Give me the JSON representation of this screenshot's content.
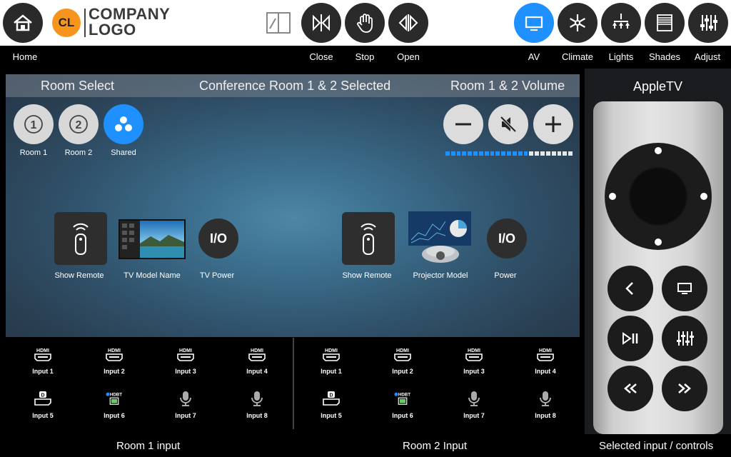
{
  "logo": {
    "mark": "CL",
    "line1": "COMPANY",
    "line2": "LOGO"
  },
  "top_icons": {
    "home": "home-icon",
    "door": "door-icon",
    "close": "close-curtain-icon",
    "stop": "stop-hand-icon",
    "open": "open-curtain-icon",
    "av": "tv-icon",
    "climate": "snowflake-icon",
    "lights": "chandelier-icon",
    "shades": "shades-icon",
    "adjust": "sliders-icon"
  },
  "nav": {
    "home": "Home",
    "close": "Close",
    "stop": "Stop",
    "open": "Open",
    "av": "AV",
    "climate": "Climate",
    "lights": "Lights",
    "shades": "Shades",
    "adjust": "Adjust"
  },
  "colors": {
    "accent": "#1e90ff",
    "logo_orange": "#f7941d",
    "meter_on": "#1e90ff",
    "meter_off": "#e6e6e6"
  },
  "main": {
    "room_select_title": "Room Select",
    "selected_title": "Conference Room 1 & 2 Selected",
    "volume_title": "Room 1 & 2 Volume",
    "rooms": [
      {
        "num": "1",
        "label": "Room 1"
      },
      {
        "num": "2",
        "label": "Room 2"
      },
      {
        "label": "Shared"
      }
    ],
    "volume_level_segments": 15,
    "volume_total_segments": 23,
    "room1_devices": {
      "remote": "Show Remote",
      "model": "TV Model Name",
      "power": "TV Power",
      "power_glyph": "I/O"
    },
    "room2_devices": {
      "remote": "Show Remote",
      "model": "Projector Model",
      "power": "Power",
      "power_glyph": "I/O"
    }
  },
  "room1_inputs": [
    "Input 1",
    "Input 2",
    "Input 3",
    "Input 4",
    "Input 5",
    "Input 6",
    "Input 7",
    "Input 8"
  ],
  "room2_inputs": [
    "Input 1",
    "Input 2",
    "Input 3",
    "Input 4",
    "Input 5",
    "Input 6",
    "Input 7",
    "Input 8"
  ],
  "input_icon_text": {
    "hdmi": "HDMI",
    "hdbt": "HDBT"
  },
  "appletv": {
    "title": "AppleTV"
  },
  "footer": {
    "room1": "Room 1 input",
    "room2": "Room 2 Input",
    "selected": "Selected input / controls"
  }
}
